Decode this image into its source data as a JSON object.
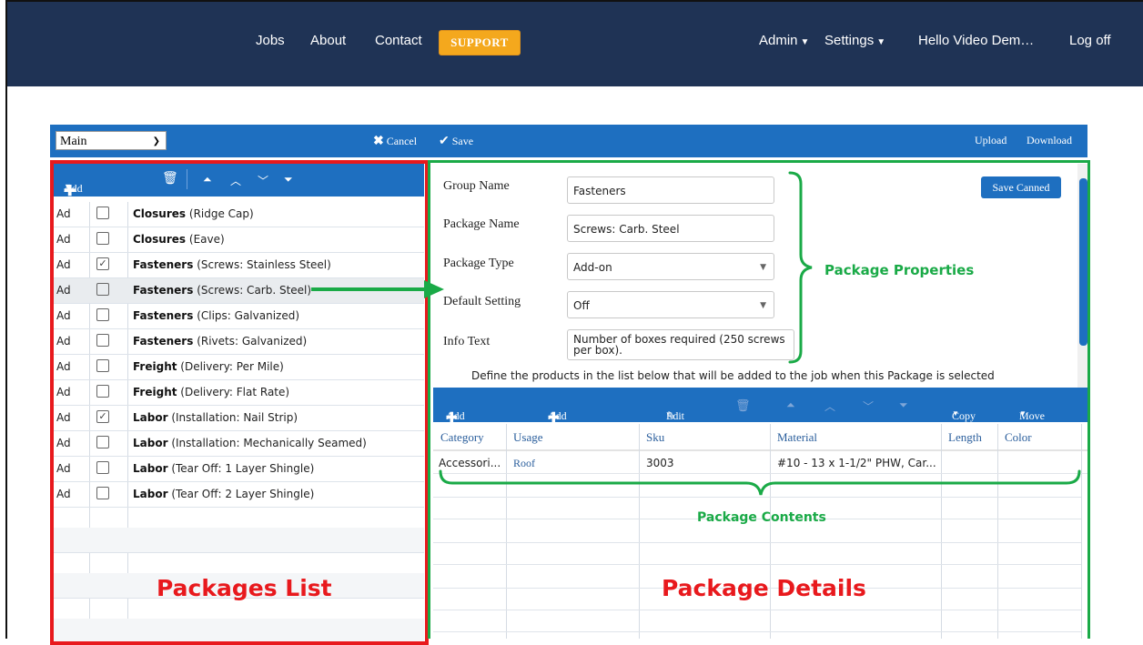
{
  "nav": {
    "items": [
      "Jobs",
      "About",
      "Contact"
    ],
    "support": "SUPPORT",
    "admin": "Admin",
    "settings": "Settings",
    "user": "Hello Video Dem…",
    "logoff": "Log off"
  },
  "toolbar": {
    "view_select": "Main",
    "cancel": "Cancel",
    "save": "Save",
    "upload": "Upload",
    "download": "Download"
  },
  "packages_toolbar": {
    "add_new": "Add New"
  },
  "packages": [
    {
      "col1": "Ad",
      "checked": false,
      "group": "Closures",
      "detail": "(Ridge Cap)"
    },
    {
      "col1": "Ad",
      "checked": false,
      "group": "Closures",
      "detail": "(Eave)"
    },
    {
      "col1": "Ad",
      "checked": true,
      "group": "Fasteners",
      "detail": "(Screws: Stainless Steel)"
    },
    {
      "col1": "Ad",
      "checked": false,
      "group": "Fasteners",
      "detail": "(Screws: Carb. Steel)"
    },
    {
      "col1": "Ad",
      "checked": false,
      "group": "Fasteners",
      "detail": "(Clips: Galvanized)"
    },
    {
      "col1": "Ad",
      "checked": false,
      "group": "Fasteners",
      "detail": "(Rivets: Galvanized)"
    },
    {
      "col1": "Ad",
      "checked": false,
      "group": "Freight",
      "detail": "(Delivery: Per Mile)"
    },
    {
      "col1": "Ad",
      "checked": false,
      "group": "Freight",
      "detail": "(Delivery: Flat Rate)"
    },
    {
      "col1": "Ad",
      "checked": true,
      "group": "Labor",
      "detail": "(Installation: Nail Strip)"
    },
    {
      "col1": "Ad",
      "checked": false,
      "group": "Labor",
      "detail": "(Installation: Mechanically Seamed)"
    },
    {
      "col1": "Ad",
      "checked": false,
      "group": "Labor",
      "detail": "(Tear Off: 1 Layer Shingle)"
    },
    {
      "col1": "Ad",
      "checked": false,
      "group": "Labor",
      "detail": "(Tear Off: 2 Layer Shingle)"
    }
  ],
  "form": {
    "group_name_label": "Group Name",
    "group_name": "Fasteners",
    "package_name_label": "Package Name",
    "package_name": "Screws: Carb. Steel",
    "package_type_label": "Package Type",
    "package_type": "Add-on",
    "default_setting_label": "Default Setting",
    "default_setting": "Off",
    "info_text_label": "Info Text",
    "info_text": "Number of boxes required (250 screws per box).",
    "save_canned": "Save Canned",
    "define_text": "Define the products in the list below that will be added to the job when this Package is selected"
  },
  "contents_toolbar": {
    "add_misc": "Add Misc",
    "add_catalog": "Add Catalog",
    "edit": "Edit",
    "copy": "Copy",
    "move": "Move"
  },
  "contents": {
    "columns": [
      "Category",
      "Usage",
      "Sku",
      "Material",
      "Length",
      "Color"
    ],
    "rows": [
      {
        "category": "Accessori...",
        "usage": "Roof",
        "sku": "3003",
        "material": "#10 - 13 x 1-1/2\" PHW, Car...",
        "length": "",
        "color": ""
      }
    ]
  },
  "annotations": {
    "packages_list": "Packages List",
    "package_details": "Package Details",
    "package_properties": "Package Properties",
    "package_contents": "Package Contents"
  },
  "colors": {
    "navbar": "#1f3355",
    "toolbar": "#1e6fc0",
    "support": "#f4a81d",
    "annotation_red": "#e8191d",
    "annotation_green": "#1aaa47"
  }
}
